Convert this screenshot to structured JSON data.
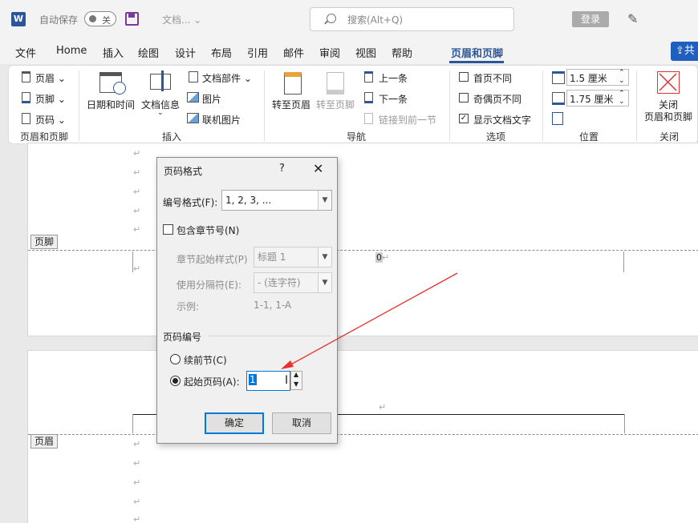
{
  "titlebar": {
    "app_icon": "W",
    "autosave_label": "自动保存",
    "autosave_state": "关",
    "doc_title": "文档... ⌄",
    "search_placeholder": "搜索(Alt+Q)",
    "login_label": "登录",
    "icons": {
      "save": "save-icon",
      "search": "search-icon",
      "pen": "pen-icon"
    }
  },
  "menu": {
    "items": [
      "文件",
      "Home",
      "插入",
      "绘图",
      "设计",
      "布局",
      "引用",
      "邮件",
      "审阅",
      "视图",
      "帮助",
      "页眉和页脚"
    ],
    "active": "页眉和页脚",
    "share_label": "共",
    "accent": "#2b579a"
  },
  "ribbon": {
    "hf_group": {
      "header": "页眉",
      "footer": "页脚",
      "page_number": "页码",
      "name": "页眉和页脚"
    },
    "insert_group": {
      "datetime": "日期和时间",
      "docinfo": "文档信息",
      "docparts": "文档部件",
      "picture": "图片",
      "online_picture": "联机图片",
      "name": "插入"
    },
    "nav_group": {
      "goto_header": "转至页眉",
      "goto_footer": "转至页脚",
      "prev": "上一条",
      "next": "下一条",
      "link_prev": "链接到前一节",
      "name": "导航"
    },
    "options_group": {
      "first_page": "首页不同",
      "odd_even": "奇偶页不同",
      "show_text": "显示文档文字",
      "show_text_checked": true,
      "name": "选项"
    },
    "position_group": {
      "header_pos": "1.5 厘米",
      "footer_pos": "1.75 厘米",
      "name": "位置"
    },
    "close_group": {
      "label_1": "关闭",
      "label_2": "页眉和页脚",
      "name": "关闭"
    }
  },
  "document": {
    "para_mark": "↵",
    "footer_tag": "页脚",
    "header_tag": "页眉",
    "page_number_field": "0"
  },
  "dialog": {
    "title": "页码格式",
    "help": "?",
    "close": "✕",
    "format_label": "编号格式(F):",
    "format_value": "1, 2, 3, ...",
    "include_chapter": "包含章节号(N)",
    "chapter_style_label": "章节起始样式(P)",
    "chapter_style_value": "标题 1",
    "separator_label": "使用分隔符(E):",
    "separator_value": "-  (连字符)",
    "example_label": "示例:",
    "example_value": "1-1, 1-A",
    "numbering_section": "页码编号",
    "continue_label": "续前节(C)",
    "start_label": "起始页码(A):",
    "start_value": "1",
    "selected_option": "start",
    "ok": "确定",
    "cancel": "取消"
  },
  "annotation": {
    "arrow_color": "#e8322b"
  }
}
